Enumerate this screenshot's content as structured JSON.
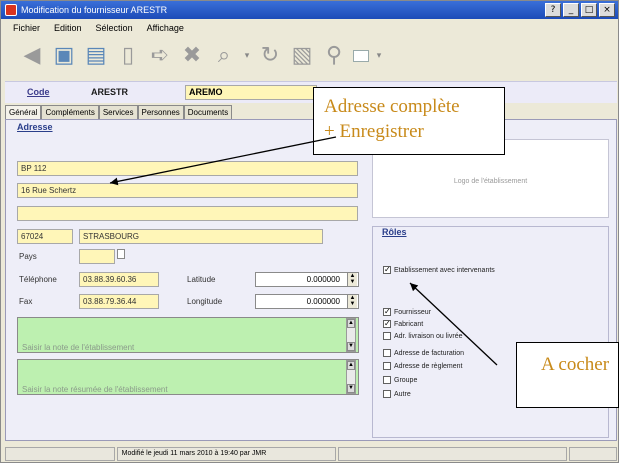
{
  "window": {
    "title": "Modification du fournisseur ARESTR",
    "controls": [
      "?",
      "_",
      "□",
      "×"
    ]
  },
  "menu": [
    "Fichier",
    "Edition",
    "Sélection",
    "Affichage"
  ],
  "header": {
    "code_label": "Code",
    "code_value": "ARESTR",
    "name_value": "AREMO"
  },
  "tabs": [
    "Général",
    "Compléments",
    "Services",
    "Personnes",
    "Documents"
  ],
  "adresse": {
    "title": "Adresse",
    "line1": "BP 112",
    "line2": "16 Rue Schertz",
    "line3": "",
    "cp": "67024",
    "ville": "STRASBOURG",
    "pays_label": "Pays",
    "pays_value": "",
    "tel_label": "Téléphone",
    "tel_value": "03.88.39.60.36",
    "fax_label": "Fax",
    "fax_value": "03.88.79.36.44",
    "latitude_label": "Latitude",
    "latitude_value": "0.000000",
    "longitude_label": "Longitude",
    "longitude_value": "0.000000",
    "note_placeholder": "Saisir la note de l'établissement",
    "note_resumee_placeholder": "Saisir la note résumée de l'établissement"
  },
  "logo": {
    "placeholder": "Logo de l'établissement"
  },
  "roles": {
    "title": "Rôles",
    "items": [
      {
        "label": "Etablissement avec intervenants",
        "checked": true
      },
      {
        "label": "Fournisseur",
        "checked": true
      },
      {
        "label": "Fabricant",
        "checked": true
      },
      {
        "label": "Adr. livraison ou livrée",
        "checked": false
      },
      {
        "label": "Adresse de facturation",
        "checked": false
      },
      {
        "label": "Adresse de règlement",
        "checked": false
      },
      {
        "label": "Groupe",
        "checked": false
      },
      {
        "label": "Autre",
        "checked": false
      }
    ]
  },
  "status": {
    "text": "Modifié le jeudi 11 mars 2010 à 19:40 par JMR"
  },
  "annotations": {
    "callout1_line1": "Adresse complète",
    "callout1_line2": "+ Enregistrer",
    "callout2": "A cocher"
  },
  "colors": {
    "title_bar": "#1c4bb8",
    "field_yellow": "#fff6b8",
    "field_green": "#bdf0b0",
    "callout_text": "#c88a1a"
  }
}
